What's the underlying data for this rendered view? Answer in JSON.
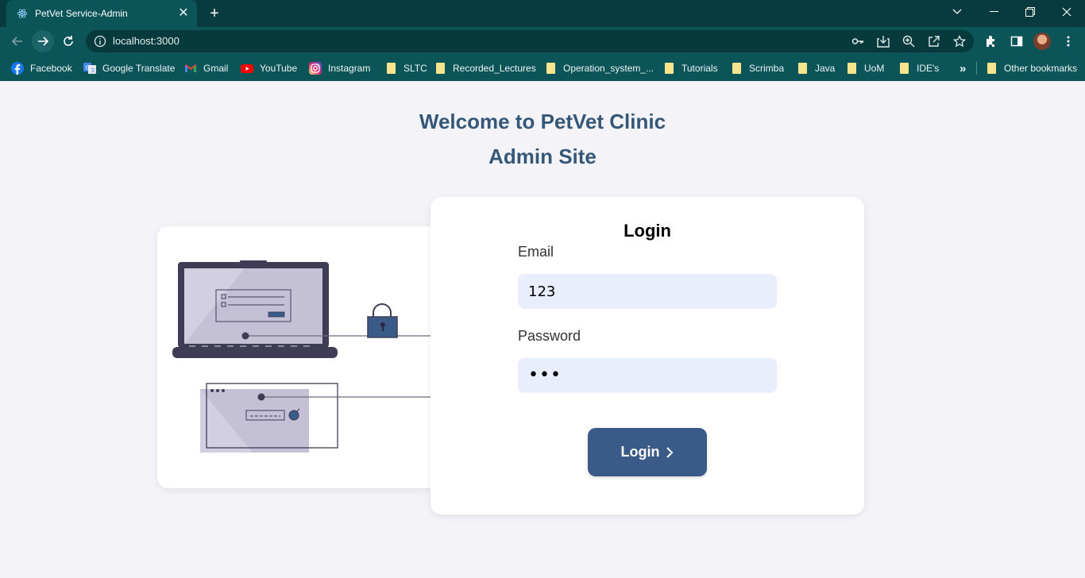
{
  "browser": {
    "tab_title": "PetVet Service-Admin",
    "tab_favicon": "react-icon",
    "url": "localhost:3000",
    "bookmarks": [
      {
        "label": "Facebook",
        "icon": "facebook-icon"
      },
      {
        "label": "Google Translate",
        "icon": "google-translate-icon"
      },
      {
        "label": "Gmail",
        "icon": "gmail-icon"
      },
      {
        "label": "YouTube",
        "icon": "youtube-icon"
      },
      {
        "label": "Instagram",
        "icon": "instagram-icon"
      },
      {
        "label": "SLTC",
        "icon": "folder-icon"
      },
      {
        "label": "Recorded_Lectures",
        "icon": "folder-icon"
      },
      {
        "label": "Operation_system_...",
        "icon": "folder-icon"
      },
      {
        "label": "Tutorials",
        "icon": "folder-icon"
      },
      {
        "label": "Scrimba",
        "icon": "folder-icon"
      },
      {
        "label": "Java",
        "icon": "folder-icon"
      },
      {
        "label": "UoM",
        "icon": "folder-icon"
      },
      {
        "label": "IDE's",
        "icon": "folder-icon"
      }
    ],
    "bookmarks_more": "»",
    "other_bookmarks": "Other bookmarks"
  },
  "page": {
    "welcome_line1": "Welcome to PetVet Clinic",
    "welcome_line2": "Admin Site",
    "login": {
      "title": "Login",
      "email_label": "Email",
      "email_value": "123",
      "password_label": "Password",
      "password_value": "•••",
      "button_label": "Login"
    }
  },
  "colors": {
    "chrome": "#0b5458",
    "tabbar": "#073b3f",
    "heading": "#355879",
    "button": "#3a5a87",
    "input_bg": "#e8eefc",
    "page_bg": "#f3f3f8"
  }
}
